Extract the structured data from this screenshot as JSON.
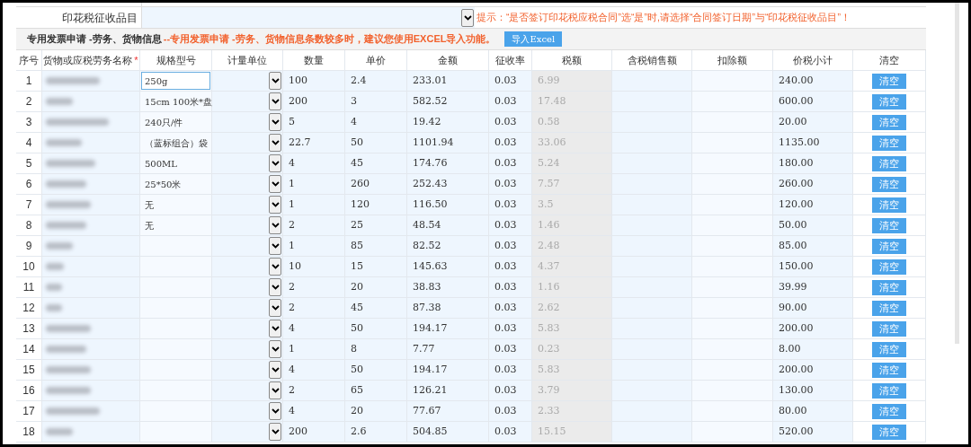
{
  "stamp_row": {
    "label": "印花税征收品目",
    "hint": "提示：“是否签订印花税应税合同”选“是”时,请选择“合同签订日期”与“印花税征收品目”！"
  },
  "section": {
    "title": "专用发票申请 -劳务、货物信息",
    "note": "--专用发票申请 -劳务、货物信息条数较多时，建议您使用EXCEL导入功能。",
    "import_button": "导入Excel"
  },
  "columns": [
    "序号",
    "货物或应税劳务名称",
    "规格型号",
    "计量单位",
    "数量",
    "单价",
    "金额",
    "征收率",
    "税额",
    "含税销售额",
    "扣除额",
    "价税小计",
    "清空"
  ],
  "required_mark": "*",
  "rows": [
    {
      "no": "1",
      "spec": "250g",
      "focused": true,
      "qty": "100",
      "price": "2.4",
      "amount": "233.01",
      "rate": "0.03",
      "tax": "6.99",
      "total": "240.00",
      "clear": "清空"
    },
    {
      "no": "2",
      "spec": "15cm 100米*盘",
      "focused": false,
      "qty": "200",
      "price": "3",
      "amount": "582.52",
      "rate": "0.03",
      "tax": "17.48",
      "total": "600.00",
      "clear": "清空"
    },
    {
      "no": "3",
      "spec": "240只/件",
      "focused": false,
      "qty": "5",
      "price": "4",
      "amount": "19.42",
      "rate": "0.03",
      "tax": "0.58",
      "total": "20.00",
      "clear": "清空"
    },
    {
      "no": "4",
      "spec": "（蓝标组合）袋",
      "focused": false,
      "qty": "22.7",
      "price": "50",
      "amount": "1101.94",
      "rate": "0.03",
      "tax": "33.06",
      "total": "1135.00",
      "clear": "清空"
    },
    {
      "no": "5",
      "spec": "500ML",
      "focused": false,
      "qty": "4",
      "price": "45",
      "amount": "174.76",
      "rate": "0.03",
      "tax": "5.24",
      "total": "180.00",
      "clear": "清空"
    },
    {
      "no": "6",
      "spec": "25*50米",
      "focused": false,
      "qty": "1",
      "price": "260",
      "amount": "252.43",
      "rate": "0.03",
      "tax": "7.57",
      "total": "260.00",
      "clear": "清空"
    },
    {
      "no": "7",
      "spec": "无",
      "focused": false,
      "qty": "1",
      "price": "120",
      "amount": "116.50",
      "rate": "0.03",
      "tax": "3.5",
      "total": "120.00",
      "clear": "清空"
    },
    {
      "no": "8",
      "spec": "无",
      "focused": false,
      "qty": "2",
      "price": "25",
      "amount": "48.54",
      "rate": "0.03",
      "tax": "1.46",
      "total": "50.00",
      "clear": "清空"
    },
    {
      "no": "9",
      "spec": "",
      "focused": false,
      "qty": "1",
      "price": "85",
      "amount": "82.52",
      "rate": "0.03",
      "tax": "2.48",
      "total": "85.00",
      "clear": "清空"
    },
    {
      "no": "10",
      "spec": "",
      "focused": false,
      "qty": "10",
      "price": "15",
      "amount": "145.63",
      "rate": "0.03",
      "tax": "4.37",
      "total": "150.00",
      "clear": "清空"
    },
    {
      "no": "11",
      "spec": "",
      "focused": false,
      "qty": "2",
      "price": "20",
      "amount": "38.83",
      "rate": "0.03",
      "tax": "1.16",
      "total": "39.99",
      "clear": "清空"
    },
    {
      "no": "12",
      "spec": "",
      "focused": false,
      "qty": "2",
      "price": "45",
      "amount": "87.38",
      "rate": "0.03",
      "tax": "2.62",
      "total": "90.00",
      "clear": "清空"
    },
    {
      "no": "13",
      "spec": "",
      "focused": false,
      "qty": "4",
      "price": "50",
      "amount": "194.17",
      "rate": "0.03",
      "tax": "5.83",
      "total": "200.00",
      "clear": "清空"
    },
    {
      "no": "14",
      "spec": "",
      "focused": false,
      "qty": "1",
      "price": "8",
      "amount": "7.77",
      "rate": "0.03",
      "tax": "0.23",
      "total": "8.00",
      "clear": "清空"
    },
    {
      "no": "15",
      "spec": "",
      "focused": false,
      "qty": "4",
      "price": "50",
      "amount": "194.17",
      "rate": "0.03",
      "tax": "5.83",
      "total": "200.00",
      "clear": "清空"
    },
    {
      "no": "16",
      "spec": "",
      "focused": false,
      "qty": "2",
      "price": "65",
      "amount": "126.21",
      "rate": "0.03",
      "tax": "3.79",
      "total": "130.00",
      "clear": "清空"
    },
    {
      "no": "17",
      "spec": "",
      "focused": false,
      "qty": "4",
      "price": "20",
      "amount": "77.67",
      "rate": "0.03",
      "tax": "2.33",
      "total": "80.00",
      "clear": "清空"
    },
    {
      "no": "18",
      "spec": "",
      "focused": false,
      "qty": "200",
      "price": "2.6",
      "amount": "504.85",
      "rate": "0.03",
      "tax": "15.15",
      "total": "520.00",
      "clear": "清空"
    }
  ]
}
